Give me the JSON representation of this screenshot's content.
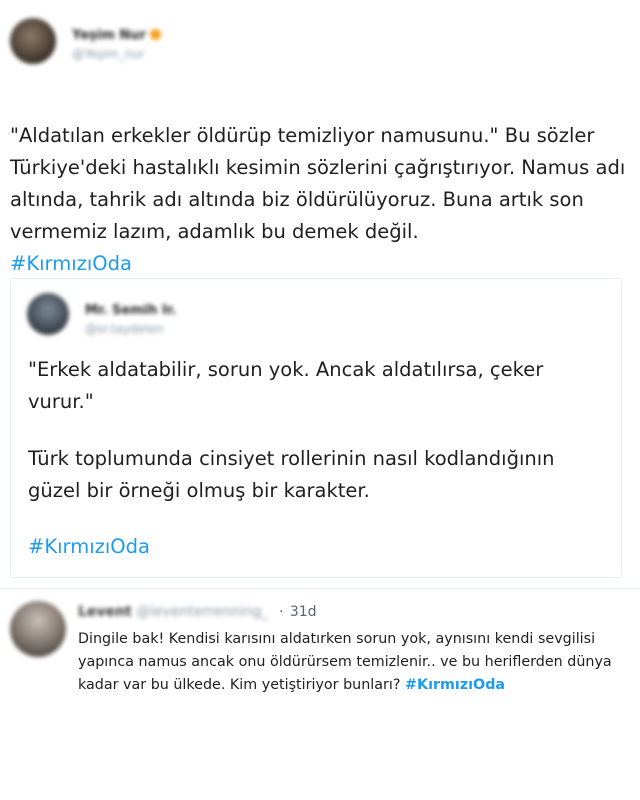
{
  "tweet": {
    "author_name": "Yeşim Nur",
    "author_handle": "@Yeşim_nur",
    "text_main": "\"Aldatılan erkekler öldürüp temizliyor namusunu.\" Bu sözler Türkiye'deki hastalıklı kesimin sözlerini çağrıştırıyor. Namus adı altında, tahrik adı altında biz öldürülüyoruz. Buna artık son vermemiz lazım, adamlık bu demek değil.",
    "hashtag": "#KırmızıOda"
  },
  "quoted_tweet": {
    "author_name": "Mr. Semih Ir.",
    "author_handle": "@sr.taydelen",
    "quote": "\"Erkek aldatabilir, sorun yok. Ancak aldatılırsa, çeker vurur.\"",
    "body": "Türk toplumunda cinsiyet rollerinin nasıl kodlandığının güzel bir örneği olmuş bir karakter.",
    "hashtag": "#KırmızıOda"
  },
  "reply": {
    "author_name": "Levent",
    "author_handle": "@leventerrenning_",
    "time_separator": "·",
    "time": "31d",
    "text": "Dingile bak! Kendisi karısını aldatırken sorun yok, aynısını kendi sevgilisi yapınca namus ancak onu öldürürsem temizlenir.. ve bu heriflerden dünya kadar var bu ülkede. Kim yetiştiriyor bunları?",
    "hashtag": "#KırmızıOda"
  },
  "colors": {
    "hashtag": "#1d9bf0",
    "text": "#1f1f1f",
    "border": "#e6ecf0"
  }
}
